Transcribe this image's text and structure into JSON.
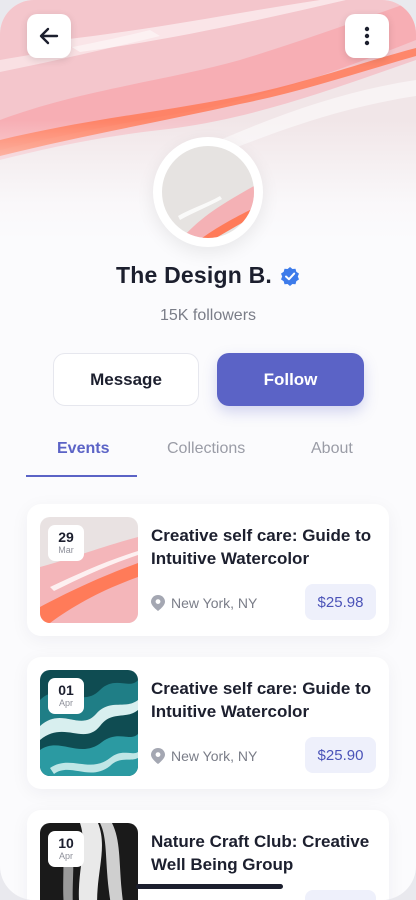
{
  "header": {
    "back_icon": "arrow-left-icon",
    "more_icon": "more-vertical-icon"
  },
  "profile": {
    "name": "The Design B.",
    "verified_icon": "verified-badge-icon",
    "followers": "15K followers"
  },
  "actions": {
    "message_label": "Message",
    "follow_label": "Follow"
  },
  "tabs": [
    {
      "label": "Events",
      "active": true
    },
    {
      "label": "Collections",
      "active": false
    },
    {
      "label": "About",
      "active": false
    }
  ],
  "events": [
    {
      "day": "29",
      "month": "Mar",
      "title": "Creative self care: Guide to Intuitive Watercolor",
      "location": "New York, NY",
      "price": "$25.98"
    },
    {
      "day": "01",
      "month": "Apr",
      "title": "Creative self care: Guide to Intuitive Watercolor",
      "location": "New York, NY",
      "price": "$25.90"
    },
    {
      "day": "10",
      "month": "Apr",
      "title": "Nature Craft Club: Creative Well Being Group",
      "location": "",
      "price": ""
    }
  ],
  "colors": {
    "accent": "#5b63c6",
    "text": "#1c1f2e",
    "muted": "#7a7d88",
    "verified": "#3d7bea",
    "price_bg": "#eef0fb"
  }
}
